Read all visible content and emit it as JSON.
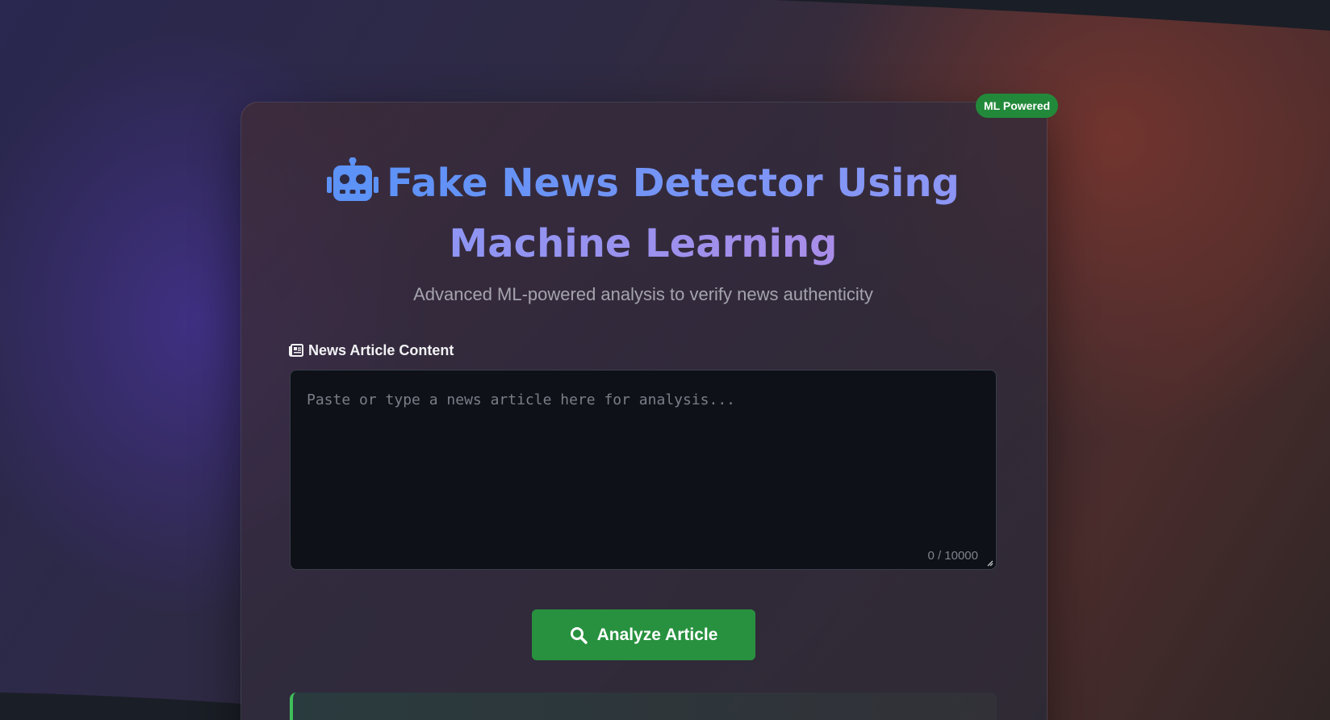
{
  "badge": "ML Powered",
  "header": {
    "icon": "robot-icon",
    "title": "Fake News Detector Using Machine Learning",
    "subtitle": "Advanced ML-powered analysis to verify news authenticity"
  },
  "form": {
    "label_icon": "newspaper-icon",
    "label": "News Article Content",
    "placeholder": "Paste or type a news article here for analysis...",
    "value": "",
    "char_count": "0 / 10000"
  },
  "analyze_button": {
    "icon": "search-icon",
    "label": "Analyze Article"
  },
  "colors": {
    "accent_green": "#28913f",
    "title_gradient_start": "#5d92f7",
    "title_gradient_end": "#a98de8"
  }
}
